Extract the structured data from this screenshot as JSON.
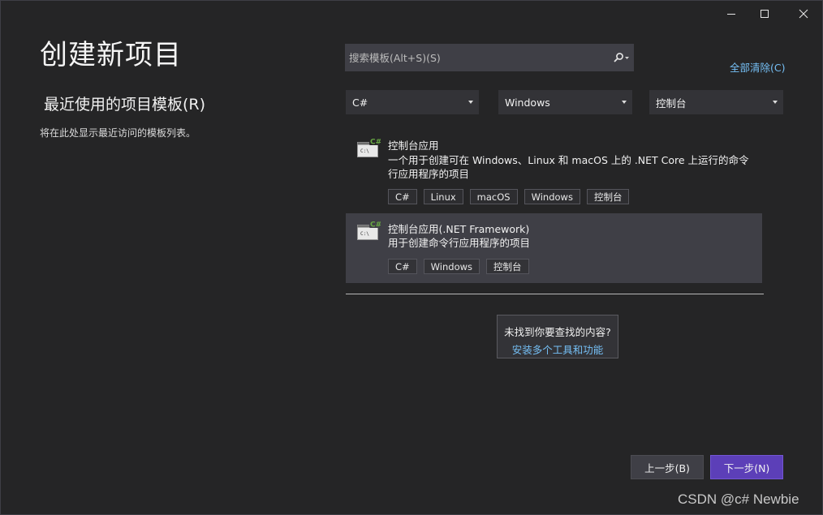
{
  "window": {
    "controls": {
      "minimize_icon": "minimize-icon",
      "maximize_icon": "maximize-icon",
      "close_icon": "close-icon"
    }
  },
  "page": {
    "title": "创建新项目",
    "recent_heading": "最近使用的项目模板(R)",
    "recent_description": "将在此处显示最近访问的模板列表。"
  },
  "search": {
    "placeholder": "搜索模板(Alt+S)(S)",
    "value": ""
  },
  "clear_all": "全部清除(C)",
  "filters": {
    "language": "C#",
    "platform": "Windows",
    "project_type": "控制台"
  },
  "templates": [
    {
      "name": "控制台应用",
      "description": "一个用于创建可在 Windows、Linux 和 macOS 上的 .NET Core 上运行的命令行应用程序的项目",
      "tags": [
        "C#",
        "Linux",
        "macOS",
        "Windows",
        "控制台"
      ],
      "selected": false
    },
    {
      "name": "控制台应用(.NET Framework)",
      "description": "用于创建命令行应用程序的项目",
      "tags": [
        "C#",
        "Windows",
        "控制台"
      ],
      "selected": true
    }
  ],
  "icon_badge": "C#",
  "icon_prompt": "C:\\",
  "not_found": {
    "question": "未找到你要查找的内容?",
    "link": "安装多个工具和功能"
  },
  "buttons": {
    "back": "上一步(B)",
    "next": "下一步(N)"
  },
  "watermark": "CSDN @c# Newbie",
  "colors": {
    "background": "#252526",
    "accent_button": "#5c3fb8",
    "link": "#75bff5",
    "selected_item": "#3f3f46",
    "csharp_badge": "#68a844"
  }
}
